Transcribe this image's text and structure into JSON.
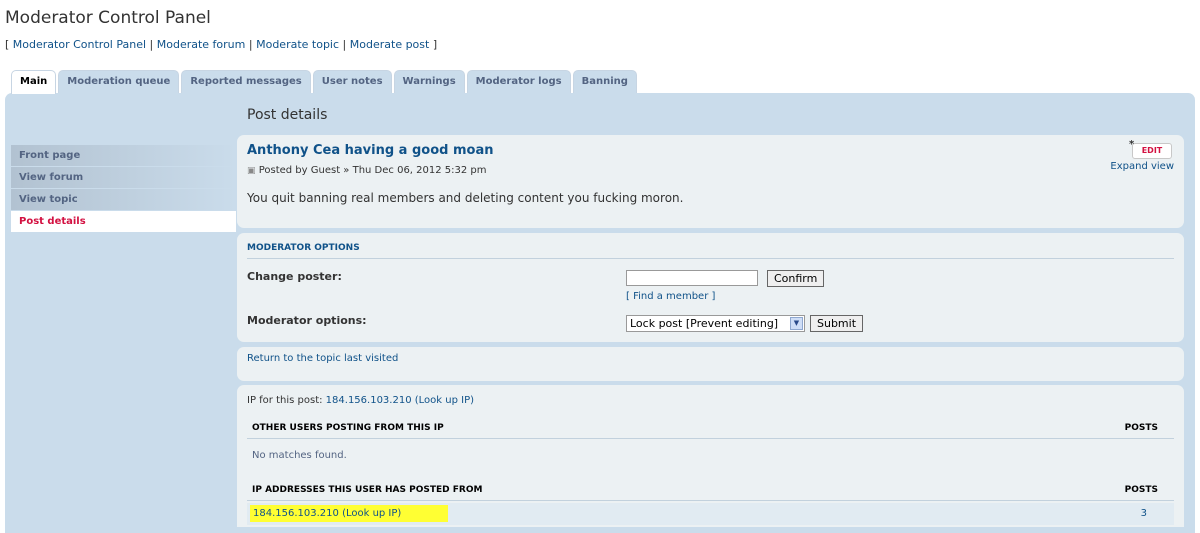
{
  "page": {
    "title": "Moderator Control Panel",
    "breadcrumbs": {
      "open": "[",
      "items": [
        "Moderator Control Panel",
        "Moderate forum",
        "Moderate topic",
        "Moderate post"
      ],
      "separator": "|",
      "close": "]"
    }
  },
  "tabs": [
    "Main",
    "Moderation queue",
    "Reported messages",
    "User notes",
    "Warnings",
    "Moderator logs",
    "Banning"
  ],
  "active_tab": "Main",
  "sidebar": {
    "items": [
      "Front page",
      "View forum",
      "View topic",
      "Post details"
    ],
    "active": "Post details"
  },
  "main": {
    "heading": "Post details",
    "post": {
      "title": "Anthony Cea having a good moan",
      "meta": "Posted by Guest » Thu Dec 06, 2012 5:32 pm",
      "body": "You quit banning real members and deleting content you fucking moron.",
      "edit_label": "EDIT",
      "expand_label": "Expand view"
    },
    "moderator_options": {
      "heading": "MODERATOR OPTIONS",
      "change_poster_label": "Change poster:",
      "change_poster_value": "",
      "confirm_label": "Confirm",
      "find_member_label": "[ Find a member ]",
      "options_label": "Moderator options:",
      "selected_option": "Lock post [Prevent editing]",
      "submit_label": "Submit"
    },
    "return_link": "Return to the topic last visited",
    "ip_info": {
      "prefix": "IP for this post:",
      "ip": "184.156.103.210",
      "lookup": "(Look up IP)",
      "other_users_header": "OTHER USERS POSTING FROM THIS IP",
      "posts_header": "POSTS",
      "no_matches": "No matches found.",
      "user_ips_header": "IP ADDRESSES THIS USER HAS POSTED FROM",
      "user_ip_row": "184.156.103.210 (Look up IP)",
      "user_ip_posts": "3"
    }
  },
  "colors": {
    "link": "#105289",
    "panel_bg": "#cadceb",
    "box_bg": "#ecf1f3",
    "active_menu": "#d31141",
    "highlight": "#ffff33"
  }
}
